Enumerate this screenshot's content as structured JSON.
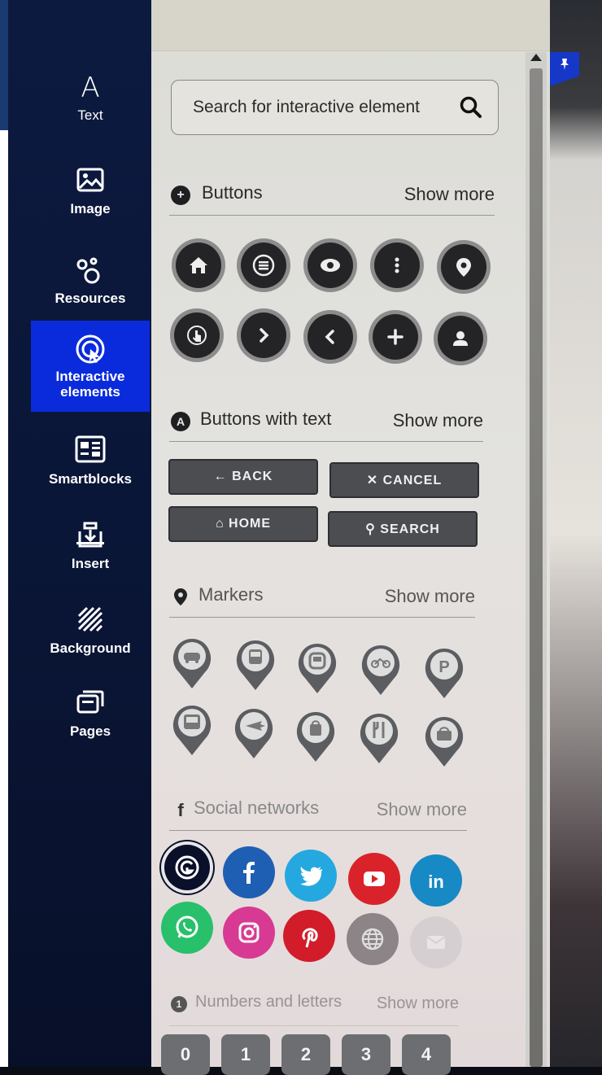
{
  "sidebar": {
    "items": [
      {
        "label": "Text",
        "icon": "text-icon",
        "active": false
      },
      {
        "label": "Image",
        "icon": "image-icon",
        "active": false
      },
      {
        "label": "Resources",
        "icon": "resources-icon",
        "active": false
      },
      {
        "label": "Interactive elements",
        "icon": "interactive-elements-icon",
        "active": true
      },
      {
        "label": "Smartblocks",
        "icon": "smartblocks-icon",
        "active": false
      },
      {
        "label": "Insert",
        "icon": "insert-icon",
        "active": false
      },
      {
        "label": "Background",
        "icon": "background-icon",
        "active": false
      },
      {
        "label": "Pages",
        "icon": "pages-icon",
        "active": false
      }
    ]
  },
  "search": {
    "placeholder": "Search for interactive element"
  },
  "sections": {
    "buttons": {
      "title": "Buttons",
      "show_more": "Show more",
      "icon": "plus-circle-icon"
    },
    "buttons_with_text": {
      "title": "Buttons with text",
      "show_more": "Show more",
      "icon": "letter-a-circle-icon"
    },
    "markers": {
      "title": "Markers",
      "show_more": "Show more",
      "icon": "map-pin-icon"
    },
    "social_networks": {
      "title": "Social networks",
      "show_more": "Show more",
      "icon": "facebook-f-icon"
    },
    "numbers_and_letters": {
      "title": "Numbers and letters",
      "show_more": "Show more",
      "icon": "number-circle-icon"
    }
  },
  "round_buttons": [
    "home-icon",
    "menu-icon",
    "eye-icon",
    "more-vertical-icon",
    "location-pin-icon",
    "pointer-hand-icon",
    "chevron-right-icon",
    "chevron-left-icon",
    "plus-icon",
    "user-icon"
  ],
  "text_buttons": {
    "back": "← BACK",
    "cancel": "✕ CANCEL",
    "home": "⌂ HOME",
    "search": "⚲ SEARCH"
  },
  "markers": [
    "car-marker",
    "train-marker",
    "metro-marker",
    "bicycle-marker",
    "parking-marker",
    "bus-marker",
    "plane-marker",
    "shopping-bag-marker",
    "restaurant-marker",
    "shop-marker"
  ],
  "social": [
    {
      "name": "genially-icon",
      "color": "#0a0f2a"
    },
    {
      "name": "facebook-icon",
      "color": "#1f5fb3"
    },
    {
      "name": "twitter-icon",
      "color": "#25a8df"
    },
    {
      "name": "youtube-icon",
      "color": "#d9222a"
    },
    {
      "name": "linkedin-icon",
      "color": "#1789c5"
    },
    {
      "name": "whatsapp-icon",
      "color": "#28c06a"
    },
    {
      "name": "instagram-icon",
      "color": "#d83a93"
    },
    {
      "name": "pinterest-icon",
      "color": "#d21c2a"
    },
    {
      "name": "web-globe-icon",
      "color": "#8d8488"
    },
    {
      "name": "email-icon",
      "color": "#d5cfd1"
    }
  ],
  "numbers": [
    "0",
    "1",
    "2",
    "3",
    "4"
  ]
}
